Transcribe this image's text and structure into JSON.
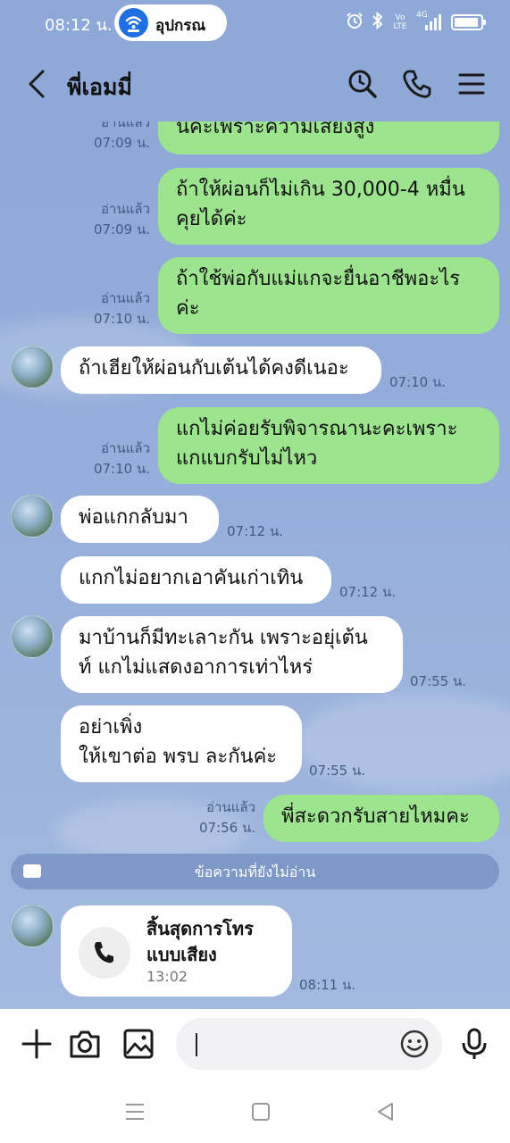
{
  "status_bar": {
    "time": "08:12 น.",
    "pill_text": "อุปกรณ",
    "icons": [
      "alarm-icon",
      "bluetooth-icon",
      "volte-icon",
      "4g-signal-icon",
      "battery-icon"
    ],
    "volte_label": "Vo LTE",
    "network_label": "4G"
  },
  "header": {
    "title": "พี่เอมมี่",
    "icons": [
      "back-arrow-icon",
      "search-icon",
      "phone-icon",
      "menu-icon"
    ]
  },
  "messages": [
    {
      "side": "out",
      "lines": [
        "นีค่ะเพราะความเสียงสูง"
      ],
      "status": "อ่านแล้ว",
      "time": "07:09 น."
    },
    {
      "side": "out",
      "lines": [
        "ถ้าให้ผ่อนก็ไม่เกิน 30,000-4 หมื่น",
        "คุยได้ค่ะ"
      ],
      "status": "อ่านแล้ว",
      "time": "07:09 น."
    },
    {
      "side": "out",
      "lines": [
        "ถ้าใช้พ่อกับแม่แกจะยื่นอาชีพอะไร",
        "ค่ะ"
      ],
      "status": "อ่านแล้ว",
      "time": "07:10 น."
    },
    {
      "side": "in",
      "lines": [
        "ถ้าเฮียให้ผ่อนกับเต้นได้คงดีเนอะ"
      ],
      "time": "07:10 น."
    },
    {
      "side": "out",
      "lines": [
        "แกไม่ค่อยรับพิจารณานะคะเพราะ",
        "แกแบกรับไม่ไหว"
      ],
      "status": "อ่านแล้ว",
      "time": "07:10 น."
    },
    {
      "side": "in",
      "lines": [
        "พ่อแกกลับมา"
      ],
      "time": "07:12 น."
    },
    {
      "side": "in",
      "lines": [
        "แกกไม่อยากเอาคันเก่าเทิน"
      ],
      "time": "07:12 น."
    },
    {
      "side": "in",
      "lines": [
        "มาบ้านก็มีทะเลาะกัน เพราะอยุ่เต้น",
        "ท์ แกไม่แสดงอาการเท่าไหร่"
      ],
      "time": "07:55 น."
    },
    {
      "side": "in",
      "lines": [
        "อย่าเพิ่ง",
        "ให้เขาต่อ พรบ ละกันค่ะ"
      ],
      "time": "07:55 น."
    },
    {
      "side": "out",
      "lines": [
        "พี่สะดวกรับสายไหมคะ"
      ],
      "status": "อ่านแล้ว",
      "time": "07:56 น."
    }
  ],
  "unread_divider": "ข้อความที่ยังไม่อ่าน",
  "call_card": {
    "title_lines": [
      "สิ้นสุดการโทร",
      "แบบเสียง"
    ],
    "duration": "13:02",
    "time": "08:11 น."
  },
  "input_bar": {
    "value": "",
    "icons": [
      "plus-icon",
      "camera-icon",
      "image-icon",
      "emoji-icon",
      "microphone-icon"
    ]
  },
  "nav_bar": {
    "icons": [
      "recents-icon",
      "home-icon",
      "back-icon"
    ]
  },
  "colors": {
    "chat_background": "#8ea8d8",
    "outgoing_bubble": "#9ce58e",
    "incoming_bubble": "#ffffff",
    "meta_text": "#455a80"
  }
}
